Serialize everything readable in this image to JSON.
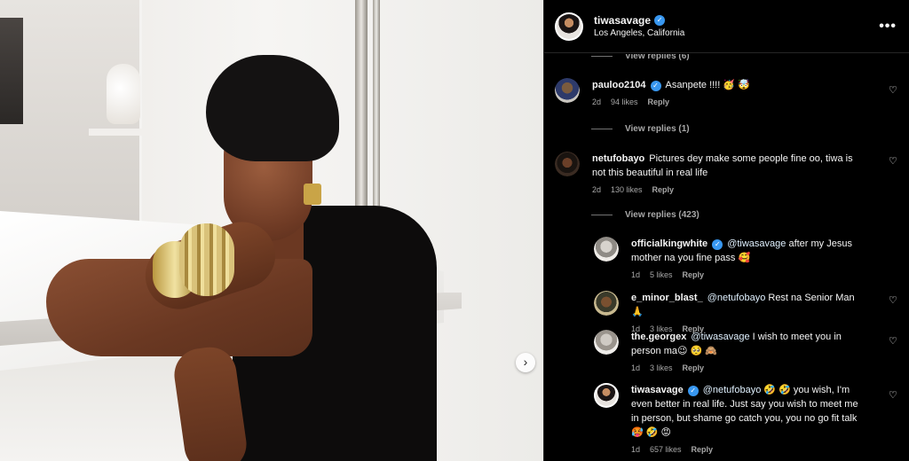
{
  "header": {
    "username": "tiwasavage",
    "location": "Los Angeles, California",
    "more_label": "•••"
  },
  "carousel": {
    "next_glyph": "›"
  },
  "view_replies_top": "View replies (6)",
  "comments": [
    {
      "username": "pauloo2104",
      "verified": true,
      "text": "Asanpete !!!! 🥳 🤯",
      "time": "2d",
      "likes": "94 likes",
      "reply": "Reply",
      "view_replies": "View replies (1)"
    },
    {
      "username": "netufobayo",
      "verified": false,
      "text": "Pictures dey make some people fine oo, tiwa is not this beautiful in real life",
      "time": "2d",
      "likes": "130 likes",
      "reply": "Reply",
      "view_replies": "View replies (423)"
    }
  ],
  "replies": [
    {
      "username": "officialkingwhite",
      "verified": true,
      "mention": "@tiwasavage",
      "text": "after my Jesus mother na you fine pass 🥰",
      "time": "1d",
      "likes": "5 likes",
      "reply": "Reply"
    },
    {
      "username": "e_minor_blast_",
      "verified": false,
      "mention": "@netufobayo",
      "text": "Rest na Senior Man 🙏",
      "time": "1d",
      "likes": "3 likes",
      "reply": "Reply"
    },
    {
      "username": "the.georgex",
      "verified": false,
      "mention": "@tiwasavage",
      "text": "I wish to meet you in person ma😉 🥺 🙈",
      "time": "1d",
      "likes": "3 likes",
      "reply": "Reply"
    },
    {
      "username": "tiwasavage",
      "verified": true,
      "mention": "@netufobayo",
      "text": "🤣 🤣 you wish, I'm even better in real life. Just say you wish to meet me in person, but shame go catch you, you no go fit talk 🥵 🤣 😡",
      "time": "1d",
      "likes": "657 likes",
      "reply": "Reply"
    }
  ],
  "colors": {
    "background": "#000000",
    "text": "#f5f5f5",
    "secondary_text": "#a8a8a8",
    "verified": "#3897f0",
    "mention": "#e0f1ff"
  },
  "icons": {
    "heart": "♡",
    "verified": "✓"
  }
}
